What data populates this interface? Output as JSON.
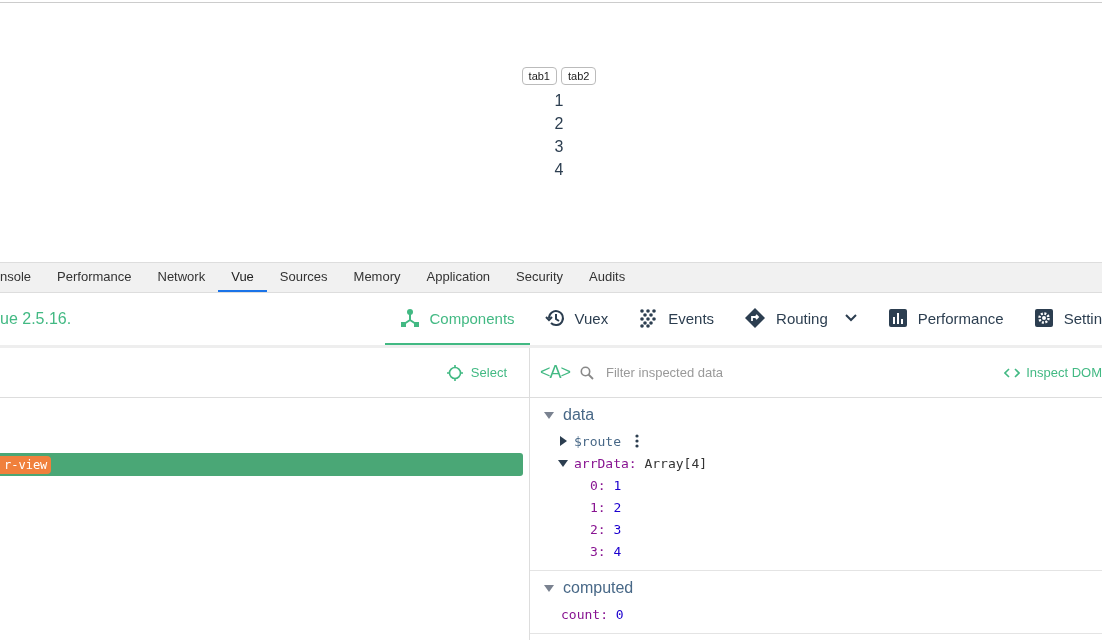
{
  "page": {
    "tabs": [
      {
        "label": "tab1"
      },
      {
        "label": "tab2"
      }
    ],
    "list": [
      "1",
      "2",
      "3",
      "4"
    ]
  },
  "devtools_tabs": [
    {
      "label": "nsole",
      "selected": false
    },
    {
      "label": "Performance",
      "selected": false
    },
    {
      "label": "Network",
      "selected": false
    },
    {
      "label": "Vue",
      "selected": true
    },
    {
      "label": "Sources",
      "selected": false
    },
    {
      "label": "Memory",
      "selected": false
    },
    {
      "label": "Application",
      "selected": false
    },
    {
      "label": "Security",
      "selected": false
    },
    {
      "label": "Audits",
      "selected": false
    }
  ],
  "vue_header": {
    "version": "ue 2.5.16.",
    "nav": [
      {
        "kind": "components",
        "label": "Components",
        "selected": true
      },
      {
        "kind": "vuex",
        "label": "Vuex",
        "selected": false
      },
      {
        "kind": "events",
        "label": "Events",
        "selected": false
      },
      {
        "kind": "routing",
        "label": "Routing",
        "selected": false
      },
      {
        "kind": "performance",
        "label": "Performance",
        "selected": false
      },
      {
        "kind": "settings",
        "label": "Settin",
        "selected": false
      }
    ]
  },
  "components_pane": {
    "select_label": "Select",
    "tree": [
      {
        "tag": "r-view",
        "selected": true
      }
    ]
  },
  "inspector": {
    "class_toggle": "<A>",
    "filter_placeholder": "Filter inspected data",
    "inspect_dom": "Inspect DOM",
    "sections": [
      {
        "title": "data",
        "expanded": true,
        "props": [
          {
            "key": "$route",
            "kind": "object",
            "expanded": false,
            "menu": true
          },
          {
            "key": "arrData:",
            "value": "Array[4]",
            "kind": "array",
            "expanded": true,
            "children": [
              {
                "key": "0:",
                "value": "1"
              },
              {
                "key": "1:",
                "value": "2"
              },
              {
                "key": "2:",
                "value": "3"
              },
              {
                "key": "3:",
                "value": "4"
              }
            ]
          }
        ]
      },
      {
        "title": "computed",
        "expanded": true,
        "props": [
          {
            "key": "count:",
            "value": "0",
            "kind": "number"
          }
        ]
      }
    ]
  }
}
